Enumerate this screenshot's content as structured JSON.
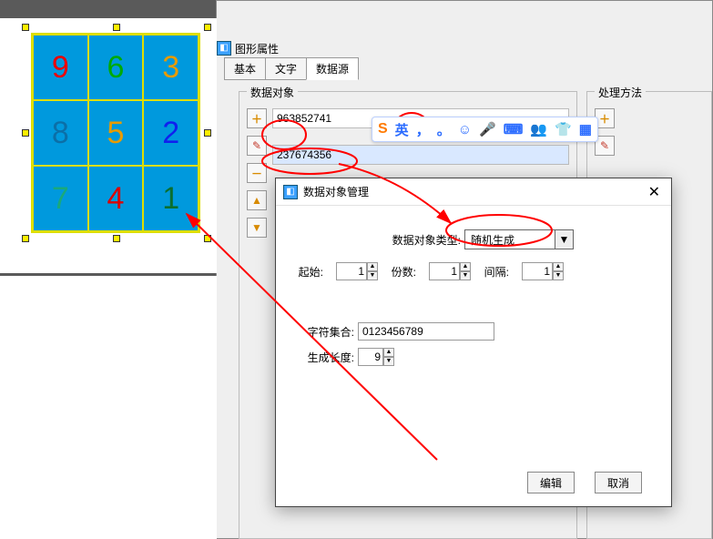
{
  "panel_title": "图形属性",
  "tabs": {
    "basic": "基本",
    "text": "文字",
    "data": "数据源"
  },
  "group": {
    "data_label": "数据对象",
    "proc_label": "处理方法"
  },
  "list": {
    "row0": "963852741",
    "row1": "237674356"
  },
  "modal": {
    "title": "数据对象管理",
    "type_label": "数据对象类型:",
    "type_value": "随机生成",
    "start_label": "起始:",
    "start_val": "1",
    "count_label": "份数:",
    "count_val": "1",
    "gap_label": "间隔:",
    "gap_val": "1",
    "charset_label": "字符集合:",
    "charset_val": "0123456789",
    "len_label": "生成长度:",
    "len_val": "9",
    "edit_btn": "编辑",
    "cancel_btn": "取消"
  },
  "grid": {
    "r0c0": "9",
    "r0c1": "6",
    "r0c2": "3",
    "r1c0": "8",
    "r1c1": "5",
    "r1c2": "2",
    "r2c0": "7",
    "r2c1": "4",
    "r2c2": "1"
  },
  "colors": {
    "r0c0": "#ef0000",
    "r0c1": "#00aa00",
    "r0c2": "#e79b00",
    "r1c0": "#0b6fa7",
    "r1c1": "#e79b00",
    "r1c2": "#1020ee",
    "r2c0": "#1aa97a",
    "r2c1": "#dd0000",
    "r2c2": "#0b6f2f"
  },
  "ime": {
    "lang": "英",
    "comma": "，",
    "dot": "。"
  },
  "icons": {
    "plus": "＋",
    "minus": "－",
    "pencil": "✎",
    "up": "▲",
    "down": "▼",
    "face": "☺",
    "mic": "🎤",
    "kbd": "⌨",
    "people": "👥",
    "shirt": "👕",
    "grid": "▦"
  }
}
